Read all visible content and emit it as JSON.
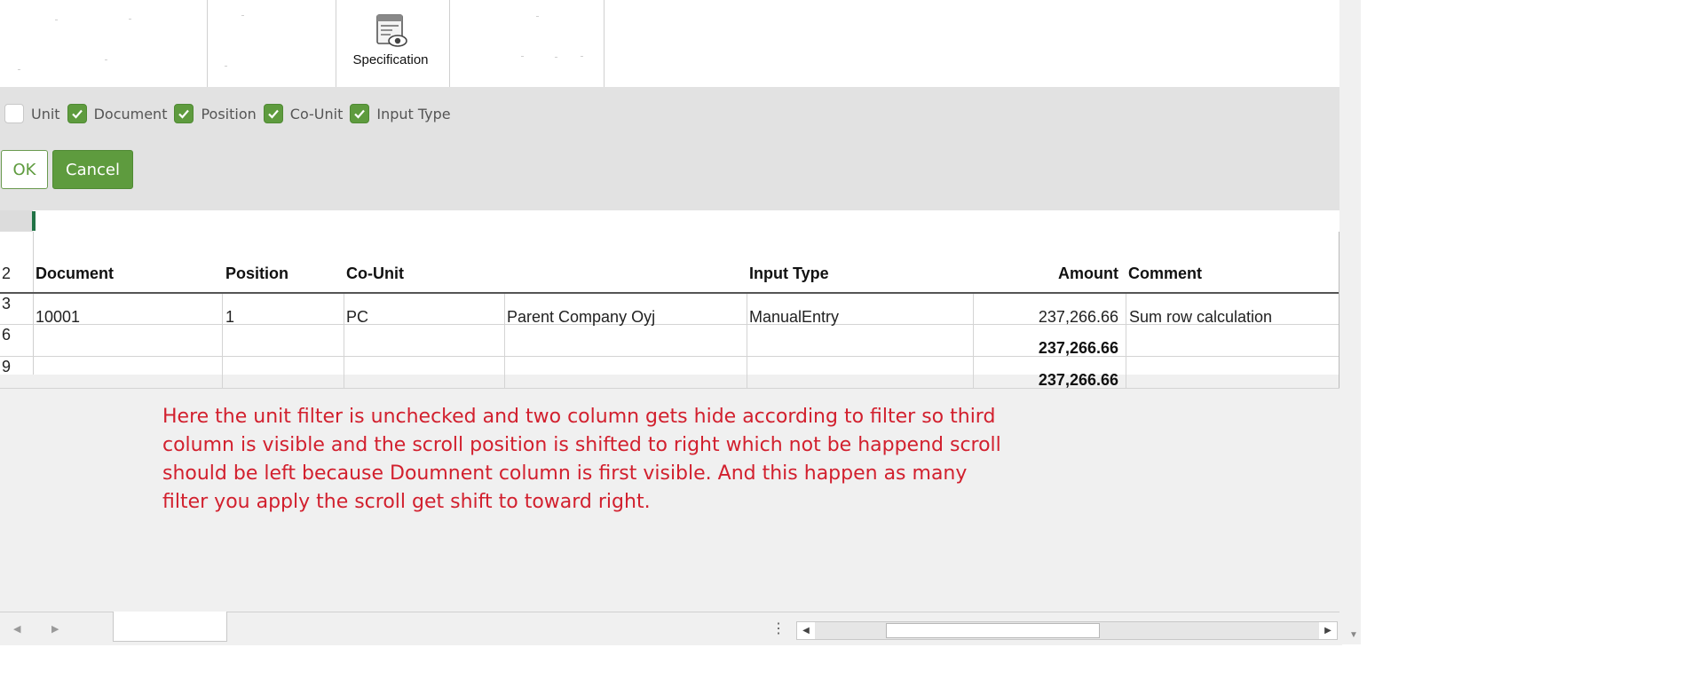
{
  "ribbon": {
    "specification_label": "Specification",
    "specification_icon": "document-view-icon"
  },
  "filters": {
    "items": [
      {
        "label": "Unit",
        "checked": false
      },
      {
        "label": "Document",
        "checked": true
      },
      {
        "label": "Position",
        "checked": true
      },
      {
        "label": "Co-Unit",
        "checked": true
      },
      {
        "label": "Input Type",
        "checked": true
      }
    ],
    "ok_label": "OK",
    "cancel_label": "Cancel"
  },
  "grid": {
    "row_numbers": [
      "2",
      "3",
      "6",
      "9"
    ],
    "headers": {
      "document": "Document",
      "position": "Position",
      "co_unit": "Co-Unit",
      "input_type": "Input Type",
      "amount": "Amount",
      "comment": "Comment"
    },
    "rows": [
      {
        "document": "10001",
        "position": "1",
        "co_unit": "PC",
        "co_unit_name": "Parent Company Oyj",
        "input_type": "ManualEntry",
        "amount": "237,266.66",
        "comment": "Sum row calculation"
      },
      {
        "document": "",
        "position": "",
        "co_unit": "",
        "co_unit_name": "",
        "input_type": "",
        "amount": "237,266.66",
        "comment": ""
      },
      {
        "document": "",
        "position": "",
        "co_unit": "",
        "co_unit_name": "",
        "input_type": "",
        "amount": "237,266.66",
        "comment": ""
      }
    ]
  },
  "annotation": {
    "lines": [
      "Here the unit filter is unchecked and two column gets hide according to filter so third",
      "column is visible and the scroll position is shifted to right which not be happend scroll",
      "should be left because Doumnent column is first visible. And this happen as many",
      "filter you apply the scroll get shift to toward right."
    ]
  },
  "colors": {
    "accent_green": "#5e9b3e",
    "annotation_red": "#d2202e",
    "panel_gray": "#e2e2e2"
  }
}
